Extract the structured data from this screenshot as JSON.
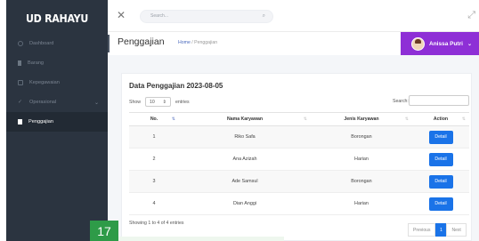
{
  "app": {
    "brand": "UD RAHAYU"
  },
  "sidebar": {
    "items": [
      {
        "label": "Dashboard",
        "icon": "dashboard-icon"
      },
      {
        "label": "Barang",
        "icon": "box-icon"
      },
      {
        "label": "Kepegawaian",
        "icon": "users-icon"
      },
      {
        "label": "Operasional",
        "icon": "check-icon",
        "has_submenu": true
      },
      {
        "label": "Penggajian",
        "icon": "document-icon",
        "active": true
      }
    ]
  },
  "topbar": {
    "search_placeholder": "Search...",
    "close_glyph": "✕",
    "search_glyph": "⌕",
    "expand_glyph": "⤢"
  },
  "subheader": {
    "title": "Penggajian",
    "breadcrumb_home": "Home",
    "breadcrumb_sep": " / ",
    "breadcrumb_current": "Penggajian"
  },
  "user": {
    "name": "Anissa Putri",
    "button_color": "#8e2fd6",
    "caret": "⌄"
  },
  "card": {
    "title": "Data Penggajian 2023-08-05",
    "show_label": "Show",
    "entries_value": "10",
    "entries_label": "entries",
    "search_label": "Search:"
  },
  "table": {
    "columns": [
      "No.",
      "Nama Karyawan",
      "Jenis Karyawan",
      "Action"
    ],
    "rows": [
      {
        "no": "1",
        "nama": "Riko Safa",
        "jenis": "Borongan",
        "action": "Detail"
      },
      {
        "no": "2",
        "nama": "Ana Azizah",
        "jenis": "Harian",
        "action": "Detail"
      },
      {
        "no": "3",
        "nama": "Ade Samsul",
        "jenis": "Borongan",
        "action": "Detail"
      },
      {
        "no": "4",
        "nama": "Dian Anggi",
        "jenis": "Harian",
        "action": "Detail"
      }
    ]
  },
  "footer": {
    "showing": "Showing 1 to 4 of 4 entries",
    "prev": "Previous",
    "page": "1",
    "next": "Next"
  },
  "overlay_badge": "17",
  "colors": {
    "sidebar_bg": "#2b3440",
    "accent_blue": "#1a73e8",
    "badge_green": "#2e9b48"
  }
}
